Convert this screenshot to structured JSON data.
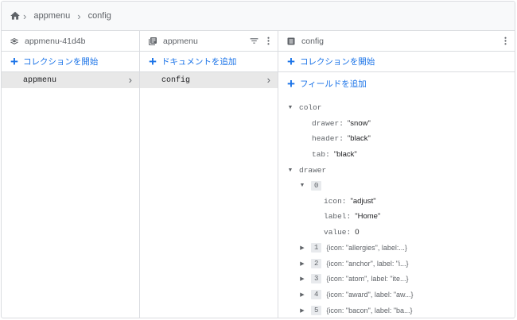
{
  "breadcrumb": [
    "appmenu",
    "config"
  ],
  "columns": {
    "project": {
      "title": "appmenu-41d4b",
      "add_label": "コレクションを開始",
      "items": [
        "appmenu"
      ]
    },
    "collection": {
      "title": "appmenu",
      "add_label": "ドキュメントを追加",
      "items": [
        "config"
      ]
    },
    "document": {
      "title": "config",
      "add_collection_label": "コレクションを開始",
      "add_field_label": "フィールドを追加"
    }
  },
  "fields": {
    "color": {
      "key": "color",
      "children": [
        {
          "key": "drawer:",
          "value": "\"snow\""
        },
        {
          "key": "header:",
          "value": "\"black\""
        },
        {
          "key": "tab:",
          "value": "\"black\""
        }
      ]
    },
    "drawer": {
      "key": "drawer",
      "expanded_index": "0",
      "expanded_children": [
        {
          "key": "icon:",
          "value": "\"adjust\""
        },
        {
          "key": "label:",
          "value": "\"Home\""
        },
        {
          "key": "value:",
          "value": "0"
        }
      ],
      "collapsed": [
        {
          "index": "1",
          "summary": "{icon: \"allergies\", label:...}"
        },
        {
          "index": "2",
          "summary": "{icon: \"anchor\", label: \"i...}"
        },
        {
          "index": "3",
          "summary": "{icon: \"atom\", label: \"ite...}"
        },
        {
          "index": "4",
          "summary": "{icon: \"award\", label: \"aw...}"
        },
        {
          "index": "5",
          "summary": "{icon: \"bacon\", label: \"ba...}"
        }
      ]
    }
  },
  "icons": {
    "home": "home-icon",
    "breadcrumb_sep": "chevron-right-icon",
    "project": "firebase-stack-icon",
    "collection": "collection-icon",
    "document": "document-icon",
    "filter": "filter-icon",
    "more": "more-vert-icon"
  },
  "colors": {
    "accent": "#1a73e8",
    "selected_bg": "#e8e8e8",
    "border": "#dadce0"
  }
}
